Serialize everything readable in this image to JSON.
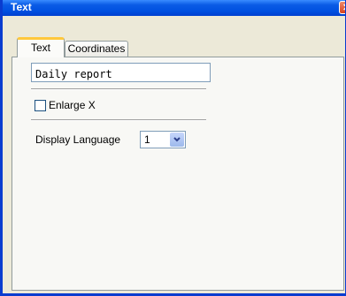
{
  "window": {
    "title": "Text",
    "close_glyph": "✕"
  },
  "tabs": [
    {
      "label": "Text",
      "active": true
    },
    {
      "label": "Coordinates",
      "active": false
    }
  ],
  "text_field": {
    "value": "Daily report"
  },
  "enlarge_x": {
    "label": "Enlarge X",
    "checked": false
  },
  "display_language": {
    "label": "Display Language",
    "selected": "1"
  },
  "colors": {
    "title_bar": "#0050e0",
    "active_tab_accent": "#ffc83c",
    "dialog_bg": "#ece9d8"
  }
}
